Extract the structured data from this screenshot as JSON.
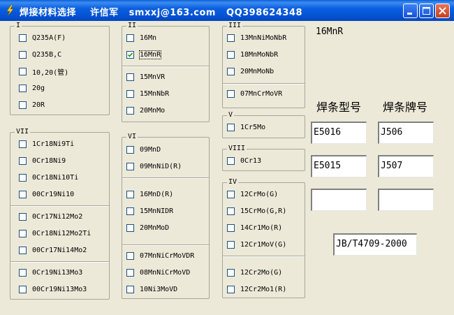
{
  "window": {
    "title": "焊接材料选择    许信军   smxxj@163.com   QQ398624348",
    "icon": "lightning-icon"
  },
  "groups": {
    "I": {
      "label": "I",
      "items": [
        {
          "label": "Q235A(F)",
          "checked": false
        },
        {
          "label": "Q235B,C",
          "checked": false
        },
        {
          "label": "10,20(管)",
          "checked": false
        },
        {
          "label": "20g",
          "checked": false
        },
        {
          "label": "20R",
          "checked": false
        }
      ]
    },
    "II": {
      "label": "II",
      "items": [
        {
          "label": "16Mn",
          "checked": false
        },
        {
          "label": "16MnR",
          "checked": true
        },
        {
          "label": "15MnVR",
          "checked": false
        },
        {
          "label": "15MnNbR",
          "checked": false
        },
        {
          "label": "20MnMo",
          "checked": false
        }
      ]
    },
    "III": {
      "label": "III",
      "items": [
        {
          "label": "13MnNiMoNbR",
          "checked": false
        },
        {
          "label": "18MnMoNbR",
          "checked": false
        },
        {
          "label": "20MnMoNb",
          "checked": false
        },
        {
          "label": "07MnCrMoVR",
          "checked": false
        }
      ]
    },
    "V": {
      "label": "V",
      "items": [
        {
          "label": "1Cr5Mo",
          "checked": false
        }
      ]
    },
    "VIII": {
      "label": "VIII",
      "items": [
        {
          "label": "0Cr13",
          "checked": false
        }
      ]
    },
    "IV": {
      "label": "IV",
      "items": [
        {
          "label": "12CrMo(G)",
          "checked": false
        },
        {
          "label": "15CrMo(G,R)",
          "checked": false
        },
        {
          "label": "14Cr1Mo(R)",
          "checked": false
        },
        {
          "label": "12Cr1MoV(G)",
          "checked": false
        },
        {
          "label": "12Cr2Mo(G)",
          "checked": false
        },
        {
          "label": "12Cr2Mo1(R)",
          "checked": false
        }
      ]
    },
    "VI": {
      "label": "VI",
      "items": [
        {
          "label": "09MnD",
          "checked": false
        },
        {
          "label": "09MnNiD(R)",
          "checked": false
        },
        {
          "label": "16MnD(R)",
          "checked": false
        },
        {
          "label": "15MnNIDR",
          "checked": false
        },
        {
          "label": "20MnMoD",
          "checked": false
        },
        {
          "label": "07MnNiCrMoVDR",
          "checked": false
        },
        {
          "label": "08MnNiCrMoVD",
          "checked": false
        },
        {
          "label": "10Ni3MoVD",
          "checked": false
        }
      ]
    },
    "VII": {
      "label": "VII",
      "items": [
        {
          "label": "1Cr18Ni9Ti",
          "checked": false
        },
        {
          "label": "0Cr18Ni9",
          "checked": false
        },
        {
          "label": "0Cr18Ni10Ti",
          "checked": false
        },
        {
          "label": "00Cr19Ni10",
          "checked": false
        },
        {
          "label": "0Cr17Ni12Mo2",
          "checked": false
        },
        {
          "label": "0Cr18Ni12Mo2Ti",
          "checked": false
        },
        {
          "label": "00Cr17Ni14Mo2",
          "checked": false
        },
        {
          "label": "0Cr19Ni13Mo3",
          "checked": false
        },
        {
          "label": "00Cr19Ni13Mo3",
          "checked": false
        }
      ]
    }
  },
  "selected_material": "16MnR",
  "headers": {
    "type": "焊条型号",
    "brand": "焊条牌号"
  },
  "results": {
    "type1": "E5016",
    "brand1": "J506",
    "type2": "E5015",
    "brand2": "J507",
    "type3": "",
    "brand3": ""
  },
  "standard": "JB/T4709-2000",
  "colors": {
    "titlebar": "#0453d4",
    "window_bg": "#ece9d8",
    "group_border": "#a7a69c"
  }
}
